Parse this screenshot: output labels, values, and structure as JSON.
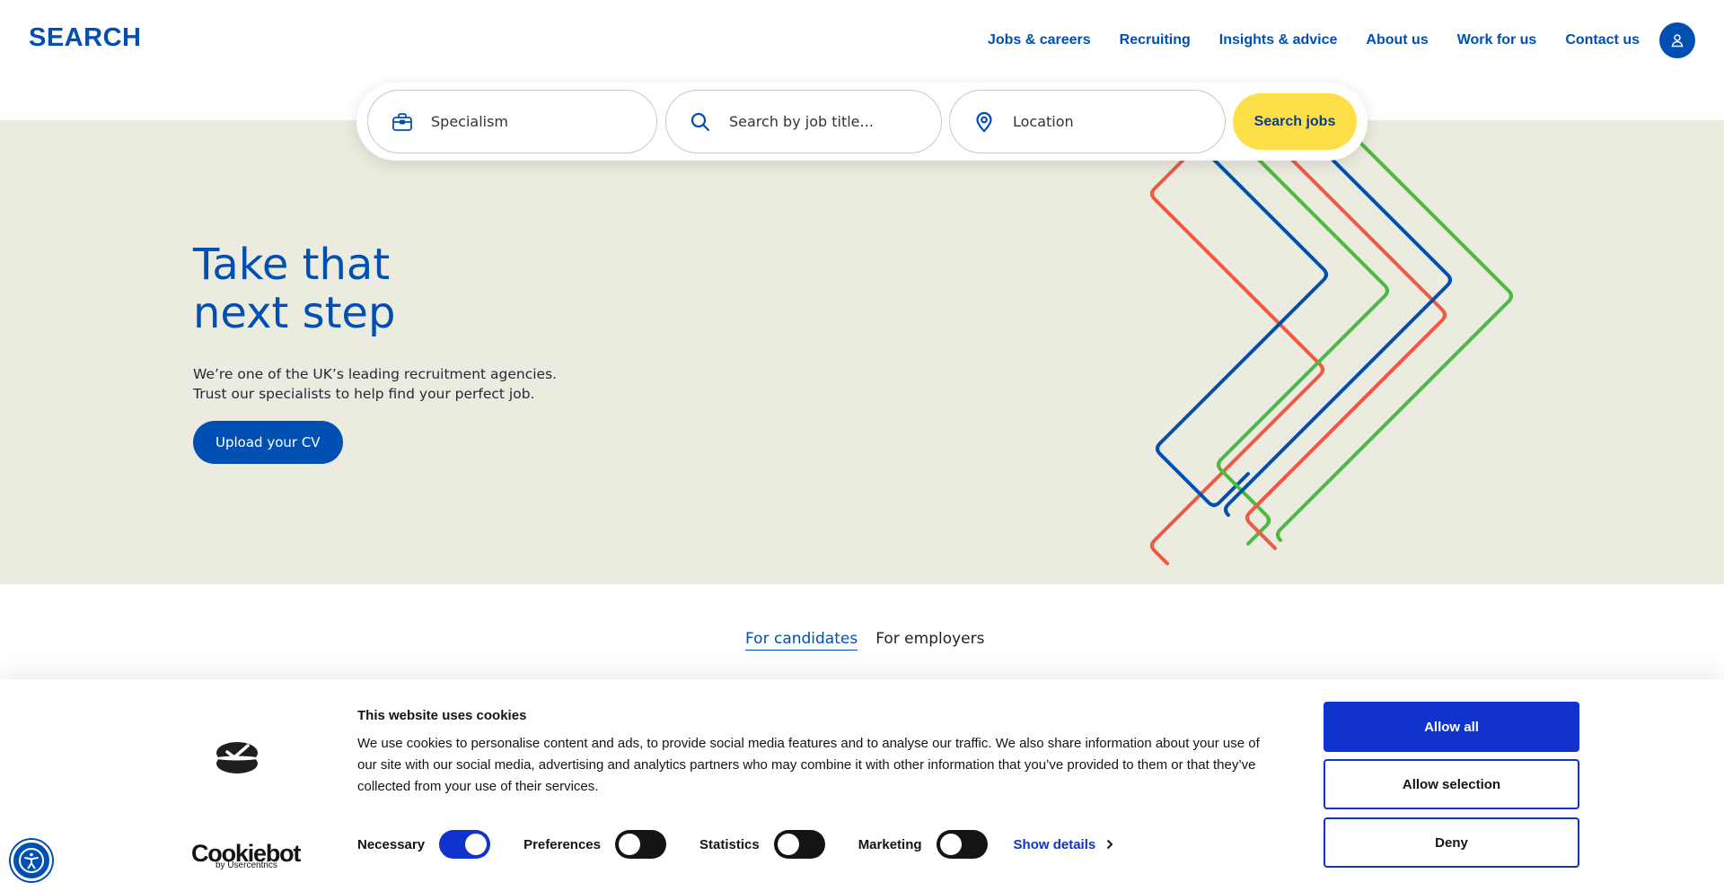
{
  "header": {
    "logo": "SEARCH",
    "nav": [
      "Jobs & careers",
      "Recruiting",
      "Insights & advice",
      "About us",
      "Work for us",
      "Contact us"
    ],
    "account_icon": "user-icon"
  },
  "search": {
    "specialism_placeholder": "Specialism",
    "job_title_placeholder": "Search by job title...",
    "location_placeholder": "Location",
    "submit_label": "Search jobs"
  },
  "hero": {
    "title_line1": "Take that",
    "title_line2": "next step",
    "desc_line1": "We’re one of the UK’s leading recruitment agencies.",
    "desc_line2": "Trust our specialists to help find your perfect job.",
    "cta_label": "Upload your CV"
  },
  "tabs": [
    {
      "label": "For candidates",
      "active": true
    },
    {
      "label": "For employers",
      "active": false
    }
  ],
  "cookie_banner": {
    "logo_text": "Cookiebot",
    "logo_sub": "by Usercentrics",
    "title": "This website uses cookies",
    "body": "We use cookies to personalise content and ads, to provide social media features and to analyse our traffic. We also share information about your use of our site with our social media, advertising and analytics partners who may combine it with other information that you’ve provided to them or that they’ve collected from your use of their services.",
    "toggles": [
      {
        "label": "Necessary",
        "on": true
      },
      {
        "label": "Preferences",
        "on": false
      },
      {
        "label": "Statistics",
        "on": false
      },
      {
        "label": "Marketing",
        "on": false
      }
    ],
    "show_details": "Show details",
    "allow_all": "Allow all",
    "allow_selection": "Allow selection",
    "deny": "Deny"
  },
  "colors": {
    "brand_blue": "#0050b3",
    "hero_bg": "#ebebdf",
    "search_button": "#fde047",
    "cookie_blue": "#1032cf",
    "chevron_red": "#ef5a45",
    "chevron_green": "#4cb944"
  }
}
